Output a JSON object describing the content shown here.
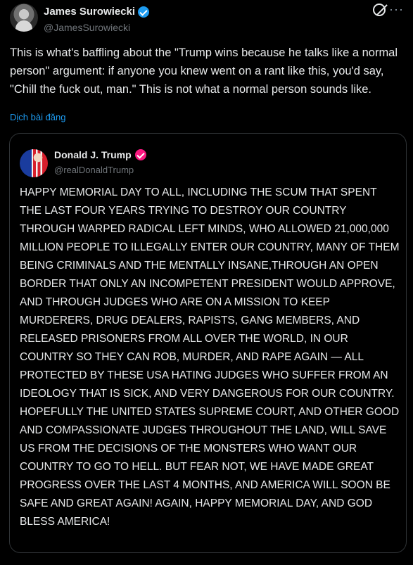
{
  "author": {
    "name": "James Surowiecki",
    "handle": "@JamesSurowiecki",
    "verified_color": "#1d9bf0"
  },
  "icons": {
    "grok": "grok-icon",
    "more": "more-icon"
  },
  "tweet": {
    "text": "This is what's baffling about the \"Trump wins because he talks like a normal person\" argument: if anyone you knew went on a rant like this, you'd say, \"Chill the fuck out, man.\" This is not what a normal person sounds like.",
    "translate_label": "Dịch bài đăng"
  },
  "quoted": {
    "name": "Donald J. Trump",
    "handle": "@realDonaldTrump",
    "verified_color": "#f91880",
    "text": "HAPPY MEMORIAL DAY TO ALL, INCLUDING THE SCUM THAT SPENT THE LAST FOUR YEARS TRYING TO DESTROY OUR COUNTRY THROUGH WARPED RADICAL LEFT MINDS, WHO ALLOWED 21,000,000 MILLION PEOPLE TO ILLEGALLY ENTER OUR COUNTRY, MANY OF THEM BEING CRIMINALS AND THE MENTALLY INSANE,THROUGH AN OPEN BORDER THAT ONLY AN INCOMPETENT PRESIDENT WOULD APPROVE, AND THROUGH JUDGES WHO ARE ON A MISSION TO KEEP MURDERERS, DRUG DEALERS, RAPISTS, GANG MEMBERS, AND RELEASED PRISONERS FROM ALL OVER THE WORLD, IN OUR COUNTRY SO THEY CAN ROB, MURDER, AND RAPE AGAIN — ALL PROTECTED BY THESE USA HATING JUDGES WHO SUFFER FROM AN IDEOLOGY THAT IS SICK, AND VERY DANGEROUS FOR OUR COUNTRY. HOPEFULLY THE UNITED STATES SUPREME COURT, AND OTHER GOOD AND COMPASSIONATE JUDGES THROUGHOUT THE LAND, WILL SAVE US FROM THE DECISIONS OF THE MONSTERS WHO WANT OUR COUNTRY TO GO TO HELL. BUT FEAR NOT, WE HAVE MADE GREAT PROGRESS OVER THE LAST 4 MONTHS, AND AMERICA WILL SOON BE SAFE AND GREAT AGAIN! AGAIN, HAPPY MEMORIAL DAY, AND GOD BLESS AMERICA!"
  }
}
